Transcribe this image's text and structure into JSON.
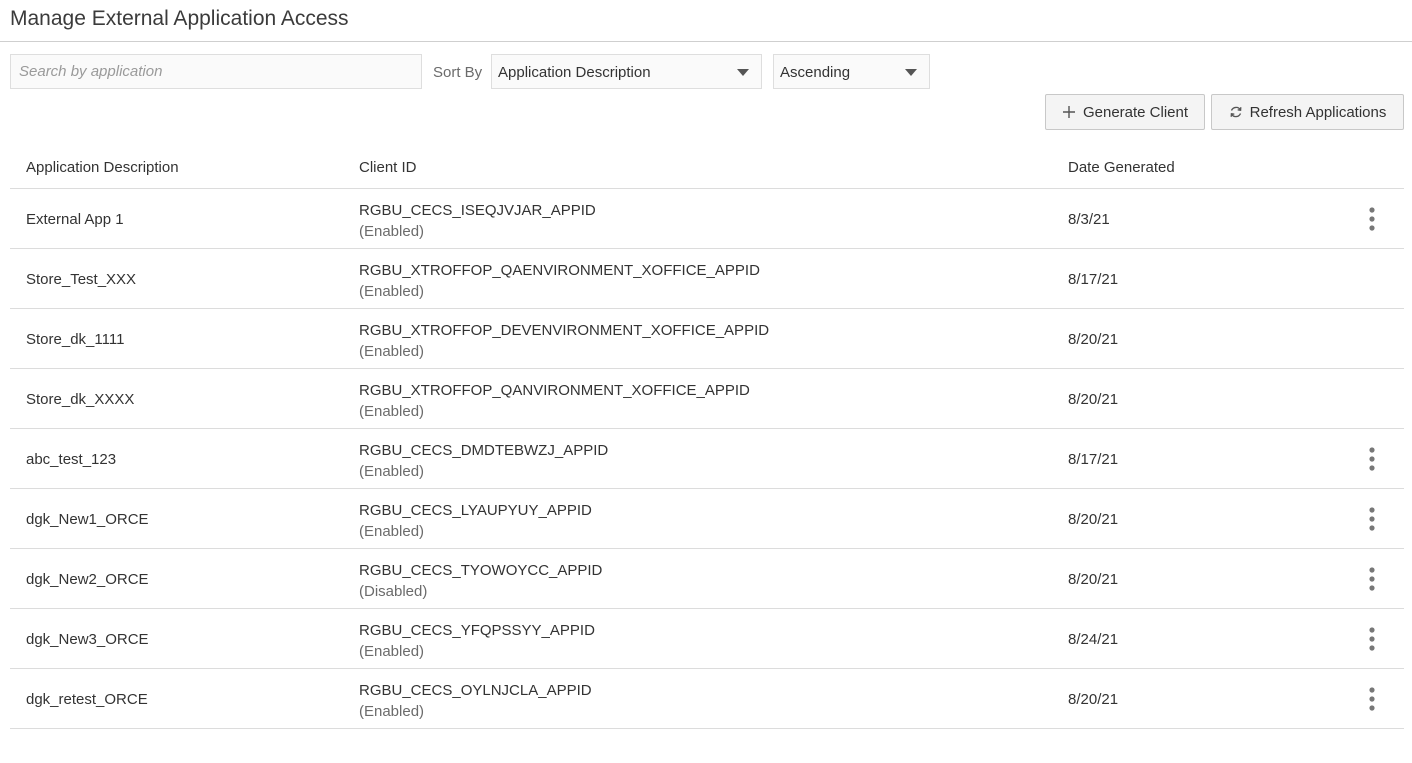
{
  "page": {
    "title": "Manage External Application Access"
  },
  "toolbar": {
    "search_placeholder": "Search by application",
    "search_value": "",
    "sort_by_label": "Sort By",
    "sort_field_value": "Application Description",
    "sort_order_value": "Ascending",
    "generate_client_label": "Generate Client",
    "refresh_applications_label": "Refresh Applications",
    "generate_icon": "plus-icon",
    "refresh_icon": "refresh-icon"
  },
  "table": {
    "headers": {
      "description": "Application Description",
      "client_id": "Client ID",
      "date_generated": "Date Generated"
    },
    "rows": [
      {
        "description": "External App 1",
        "client_id": "RGBU_CECS_ISEQJVJAR_APPID",
        "status": "(Enabled)",
        "date": "8/3/21",
        "has_actions": true
      },
      {
        "description": "Store_Test_XXX",
        "client_id": "RGBU_XTROFFOP_QAENVIRONMENT_XOFFICE_APPID",
        "status": "(Enabled)",
        "date": "8/17/21",
        "has_actions": false
      },
      {
        "description": "Store_dk_1111",
        "client_id": "RGBU_XTROFFOP_DEVENVIRONMENT_XOFFICE_APPID",
        "status": "(Enabled)",
        "date": "8/20/21",
        "has_actions": false
      },
      {
        "description": "Store_dk_XXXX",
        "client_id": "RGBU_XTROFFOP_QANVIRONMENT_XOFFICE_APPID",
        "status": "(Enabled)",
        "date": "8/20/21",
        "has_actions": false
      },
      {
        "description": "abc_test_123",
        "client_id": "RGBU_CECS_DMDTEBWZJ_APPID",
        "status": "(Enabled)",
        "date": "8/17/21",
        "has_actions": true
      },
      {
        "description": "dgk_New1_ORCE",
        "client_id": "RGBU_CECS_LYAUPYUY_APPID",
        "status": "(Enabled)",
        "date": "8/20/21",
        "has_actions": true
      },
      {
        "description": "dgk_New2_ORCE",
        "client_id": "RGBU_CECS_TYOWOYCC_APPID",
        "status": "(Disabled)",
        "date": "8/20/21",
        "has_actions": true
      },
      {
        "description": "dgk_New3_ORCE",
        "client_id": "RGBU_CECS_YFQPSSYY_APPID",
        "status": "(Enabled)",
        "date": "8/24/21",
        "has_actions": true
      },
      {
        "description": "dgk_retest_ORCE",
        "client_id": "RGBU_CECS_OYLNJCLA_APPID",
        "status": "(Enabled)",
        "date": "8/20/21",
        "has_actions": true
      }
    ],
    "row_action_icon": "kebab-menu-icon"
  },
  "colors": {
    "border": "#dcdcdc",
    "button_bg": "#f4f4f4",
    "text": "#333333",
    "muted_text": "#6b6b6b"
  }
}
